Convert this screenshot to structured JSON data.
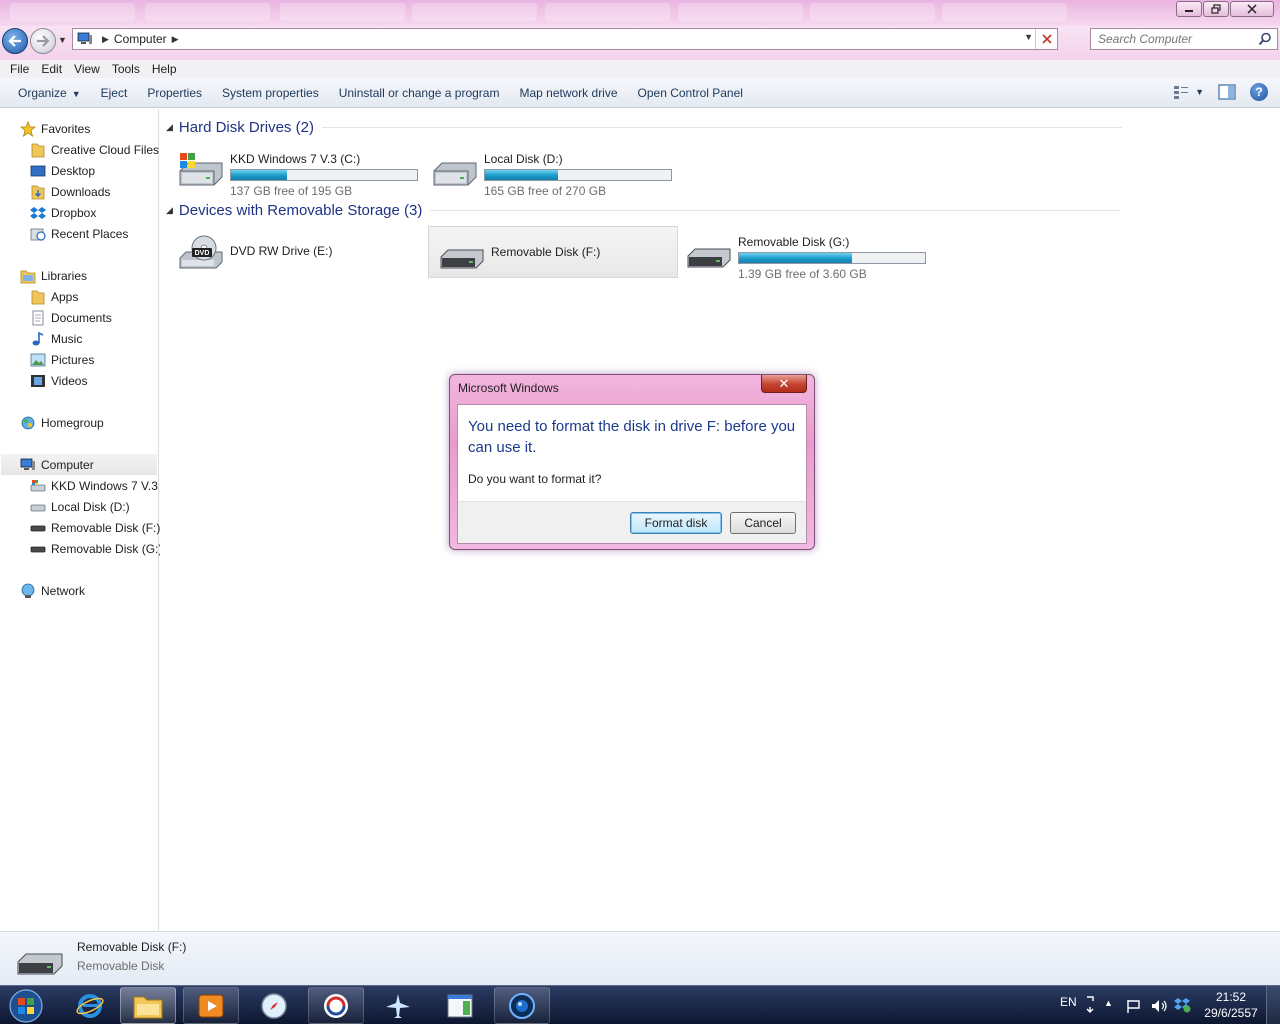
{
  "window": {
    "caption_buttons": [
      "minimize",
      "maximize",
      "close"
    ]
  },
  "address": {
    "crumb": "Computer",
    "search_placeholder": "Search Computer"
  },
  "menubar": [
    "File",
    "Edit",
    "View",
    "Tools",
    "Help"
  ],
  "commandbar": {
    "organize": "Organize",
    "eject": "Eject",
    "properties": "Properties",
    "system_properties": "System properties",
    "uninstall": "Uninstall or change a program",
    "map_drive": "Map network drive",
    "control_panel": "Open Control Panel"
  },
  "navpane": {
    "favorites": "Favorites",
    "favorites_items": [
      "Creative Cloud Files",
      "Desktop",
      "Downloads",
      "Dropbox",
      "Recent Places"
    ],
    "libraries": "Libraries",
    "libraries_items": [
      "Apps",
      "Documents",
      "Music",
      "Pictures",
      "Videos"
    ],
    "homegroup": "Homegroup",
    "computer": "Computer",
    "computer_items": [
      "KKD Windows 7 V.3",
      "Local Disk (D:)",
      "Removable Disk (F:)",
      "Removable Disk (G:)"
    ],
    "network": "Network"
  },
  "groups": {
    "hard_disks": "Hard Disk Drives (2)",
    "removable": "Devices with Removable Storage (3)"
  },
  "drives": {
    "c": {
      "name": "KKD Windows 7 V.3 (C:)",
      "free": "137 GB free of 195 GB",
      "used_fraction": 0.3
    },
    "d": {
      "name": "Local Disk (D:)",
      "free": "165 GB free of 270 GB",
      "used_fraction": 0.39
    },
    "e": {
      "name": "DVD RW Drive (E:)",
      "badge": "DVD"
    },
    "f": {
      "name": "Removable Disk (F:)"
    },
    "g": {
      "name": "Removable Disk (G:)",
      "free": "1.39 GB free of 3.60 GB",
      "used_fraction": 0.61
    }
  },
  "details": {
    "name": "Removable Disk (F:)",
    "type": "Removable Disk"
  },
  "dialog": {
    "title": "Microsoft Windows",
    "close": "✕",
    "message": "You need to format the disk in drive F: before you can use it.",
    "question": "Do you want to format it?",
    "format_button": "Format disk",
    "cancel_button": "Cancel"
  },
  "taskbar": {
    "language": "EN",
    "time": "21:52",
    "date": "29/6/2557"
  }
}
